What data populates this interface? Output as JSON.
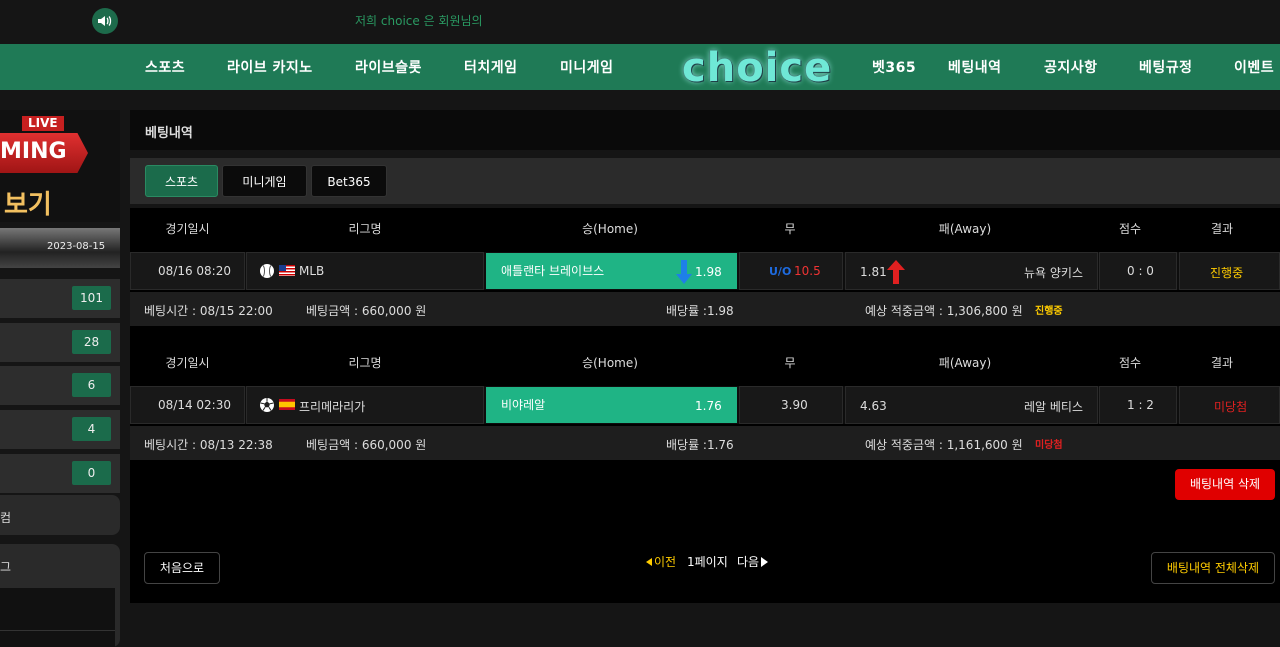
{
  "topbar": {
    "marquee": "저희 choice 은 회원님의"
  },
  "nav": {
    "left": [
      "스포츠",
      "라이브 카지노",
      "라이브슬롯",
      "터치게임",
      "미니게임"
    ],
    "logo": "choice",
    "right": [
      "벳365",
      "베팅내역",
      "공지사항",
      "베팅규정",
      "이벤트"
    ]
  },
  "sidebar": {
    "banner_live": "LIVE",
    "banner_ming": "MING",
    "banner_bogi": "보기",
    "date": "2023-08-15",
    "counts": [
      "101",
      "28",
      "6",
      "4",
      "0"
    ],
    "block1_label": "컴",
    "block2_label": "그"
  },
  "page": {
    "title": "베팅내역",
    "tabs": [
      "스포츠",
      "미니게임",
      "Bet365"
    ]
  },
  "table_headers": [
    "경기일시",
    "리그명",
    "승(Home)",
    "무",
    "패(Away)",
    "점수",
    "결과"
  ],
  "bets": [
    {
      "datetime": "08/16 08:20",
      "sport_icon": "baseball-icon",
      "flag": "usa-flag",
      "league": "MLB",
      "home_team": "애틀랜타 브레이브스",
      "home_odds": "1.98",
      "draw_label": "U/O",
      "draw_odds": "10.5",
      "away_odds": "1.81",
      "away_team": "뉴욕 양키스",
      "score": "0 : 0",
      "result": "진행중",
      "result_color": "#ffcc00",
      "bet_time": "베팅시간 : 08/15 22:00",
      "bet_amount": "베팅금액 : 660,000 원",
      "payout_rate": "배당률 :1.98",
      "expected": "예상 적중금액 : 1,306,800 원",
      "status": "진행중"
    },
    {
      "datetime": "08/14 02:30",
      "sport_icon": "soccer-icon",
      "flag": "spain-flag",
      "league": "프리메라리가",
      "home_team": "비야레알",
      "home_odds": "1.76",
      "draw_label": "",
      "draw_odds": "3.90",
      "away_odds": "4.63",
      "away_team": "레알 베티스",
      "score": "1 : 2",
      "result": "미당첨",
      "result_color": "#e02020",
      "bet_time": "베팅시간 : 08/13 22:38",
      "bet_amount": "베팅금액 : 660,000 원",
      "payout_rate": "배당률 :1.76",
      "expected": "예상 적중금액 : 1,161,600 원",
      "status": "미당첨"
    }
  ],
  "actions": {
    "delete_bets": "배팅내역 삭제",
    "first_page": "처음으로",
    "prev": "이전",
    "page_label": "1페이지",
    "next": "다음",
    "delete_all": "배팅내역 전체삭제"
  },
  "colors": {
    "nav_green": "#1f7a56",
    "home_highlight": "#1fb485",
    "pending": "#ffcc00",
    "lost": "#e02020",
    "delete_red": "#e00000"
  }
}
